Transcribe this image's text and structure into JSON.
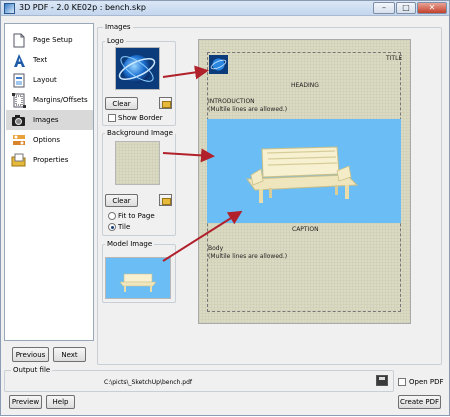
{
  "window": {
    "title": "3D PDF - 2.0 KE02p : bench.skp",
    "minimize": "–",
    "maximize": "□",
    "close": "✕"
  },
  "sidebar": {
    "items": [
      {
        "label": "Page Setup",
        "icon": "page-setup-icon"
      },
      {
        "label": "Text",
        "icon": "text-icon"
      },
      {
        "label": "Layout",
        "icon": "layout-icon"
      },
      {
        "label": "Margins/Offsets",
        "icon": "margins-icon"
      },
      {
        "label": "Images",
        "icon": "camera-icon",
        "active": true
      },
      {
        "label": "Options",
        "icon": "options-icon"
      },
      {
        "label": "Properties",
        "icon": "properties-icon"
      }
    ]
  },
  "nav": {
    "previous": "Previous",
    "next": "Next"
  },
  "images": {
    "section_label": "Images",
    "logo": {
      "label": "Logo",
      "clear": "Clear",
      "show_border": "Show Border",
      "show_border_checked": false
    },
    "background": {
      "label": "Background Image",
      "clear": "Clear",
      "fit_to_page": "Fit to Page",
      "tile": "Tile",
      "selected": "Tile"
    },
    "model": {
      "label": "Model Image"
    }
  },
  "preview": {
    "title": "TITLE",
    "heading": "HEADING",
    "introduction": "INTRODUCTION",
    "intro_note": "(Multile lines are allowed.)",
    "caption": "CAPTION",
    "body": "Body",
    "body_note": "(Multile lines are allowed.)"
  },
  "output": {
    "label": "Output file",
    "path": "C:\\picts\\_SketchUp\\bench.pdf",
    "open_pdf": "Open PDF",
    "open_pdf_checked": false
  },
  "footer": {
    "preview": "Preview",
    "help": "Help",
    "create": "Create PDF"
  },
  "colors": {
    "model_bg": "#6bbef5",
    "paper": "#dad9c2",
    "arrow": "#b0212b"
  }
}
